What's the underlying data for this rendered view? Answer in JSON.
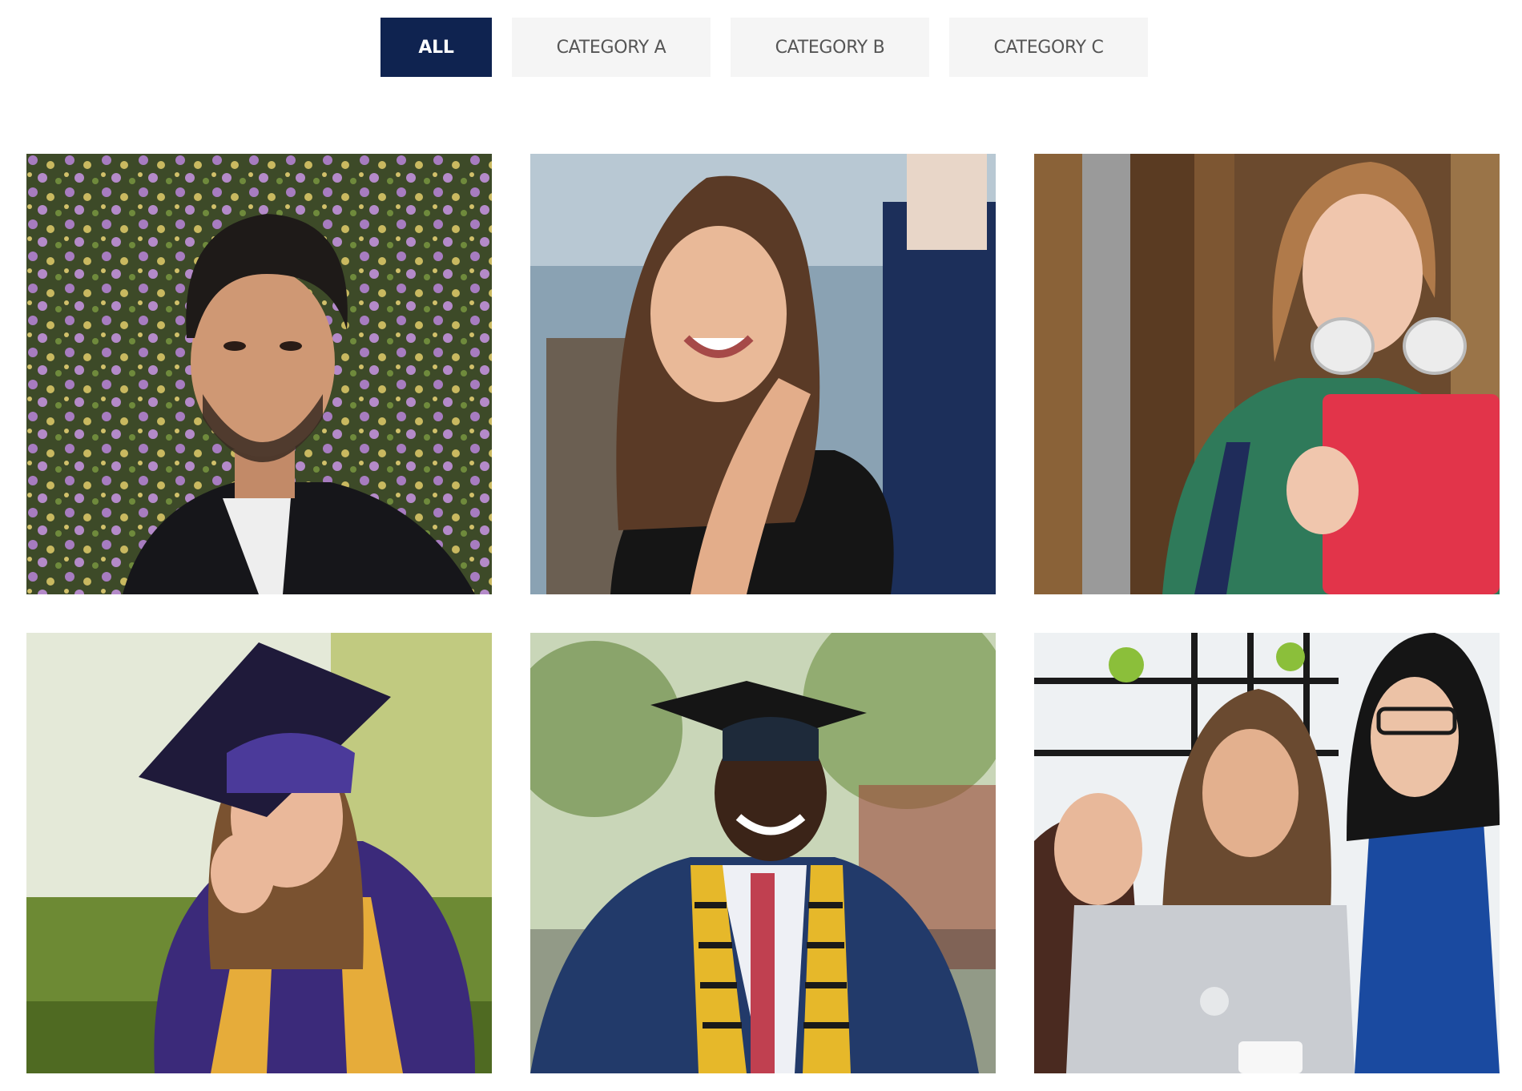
{
  "filters": {
    "items": [
      {
        "label": "ALL",
        "active": true
      },
      {
        "label": "CATEGORY A",
        "active": false
      },
      {
        "label": "CATEGORY B",
        "active": false
      },
      {
        "label": "CATEGORY C",
        "active": false
      }
    ]
  },
  "gallery": {
    "photos": [
      {
        "subject": "man-portrait-flowers"
      },
      {
        "subject": "smiling-woman-cafe"
      },
      {
        "subject": "student-with-headphones-folder"
      },
      {
        "subject": "graduate-woman-on-grass"
      },
      {
        "subject": "graduate-man-kente-stole"
      },
      {
        "subject": "women-at-laptop"
      }
    ]
  },
  "colors": {
    "active_tab_bg": "#0f2350",
    "inactive_tab_bg": "#f5f5f5",
    "tab_text": "#555555"
  }
}
